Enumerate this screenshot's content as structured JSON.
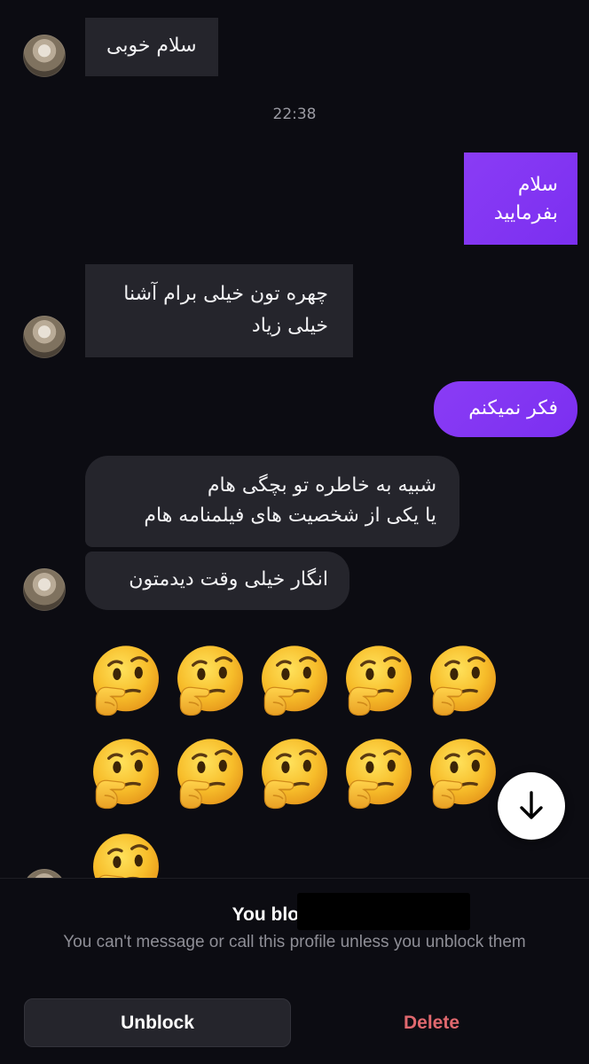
{
  "messages": [
    {
      "from": "them",
      "text": "سلام خوبی"
    },
    {
      "timestamp": "22:38"
    },
    {
      "from": "me",
      "lines": [
        "سلام",
        "بفرمایید"
      ]
    },
    {
      "from": "them",
      "lines": [
        "چهره تون خیلی برام آشنا",
        "خیلی زیاد"
      ]
    },
    {
      "from": "me",
      "text": "فکر نمیکنم"
    },
    {
      "from": "them",
      "lines": [
        "شبیه به خاطره تو بچگی هام",
        "یا یکی از شخصیت های فیلمنامه هام"
      ]
    },
    {
      "from": "them",
      "text": "انگار خیلی وقت دیدمتون"
    },
    {
      "from": "them",
      "emoji": "🤔",
      "count": 11
    }
  ],
  "colors": {
    "background": "#0c0c12",
    "incoming_bubble": "#25252c",
    "outgoing_bubble": "#8a3cf5",
    "delete_text": "#e0686e"
  },
  "icons": {
    "scroll": "arrow-down-icon",
    "emoji": "thinking-face-emoji"
  },
  "footer": {
    "title": "You blocked 1",
    "subtitle": "You can't message or call this profile unless you unblock them",
    "unblock_label": "Unblock",
    "delete_label": "Delete"
  }
}
